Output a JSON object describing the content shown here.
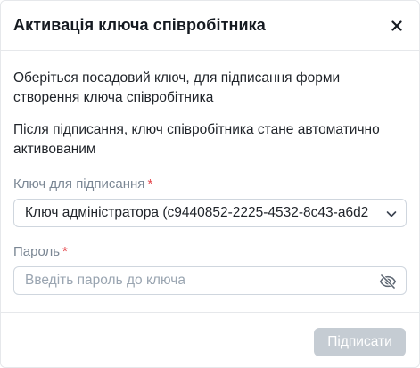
{
  "dialog": {
    "title": "Активація ключа співробітника",
    "close_label": "✕"
  },
  "body": {
    "paragraph_1": "Оберіться посадовий ключ, для підписання форми створення ключа співробітника",
    "paragraph_2": "Після підписання, ключ співробітника стане автоматично активованим"
  },
  "key_field": {
    "label": "Ключ для підписання",
    "required_mark": "*",
    "value": "Ключ адміністратора (c9440852-2225-4532-8c43-a6d2"
  },
  "password_field": {
    "label": "Пароль",
    "required_mark": "*",
    "value": "",
    "placeholder": "Введіть пароль до ключа"
  },
  "footer": {
    "submit_label": "Підписати"
  },
  "colors": {
    "required": "#e5484d",
    "disabled_button": "#c5ccd3",
    "border": "#cfd6de"
  },
  "icons": {
    "close": "close-icon",
    "dropdown": "chevron-down-icon",
    "visibility": "eye-off-icon"
  }
}
